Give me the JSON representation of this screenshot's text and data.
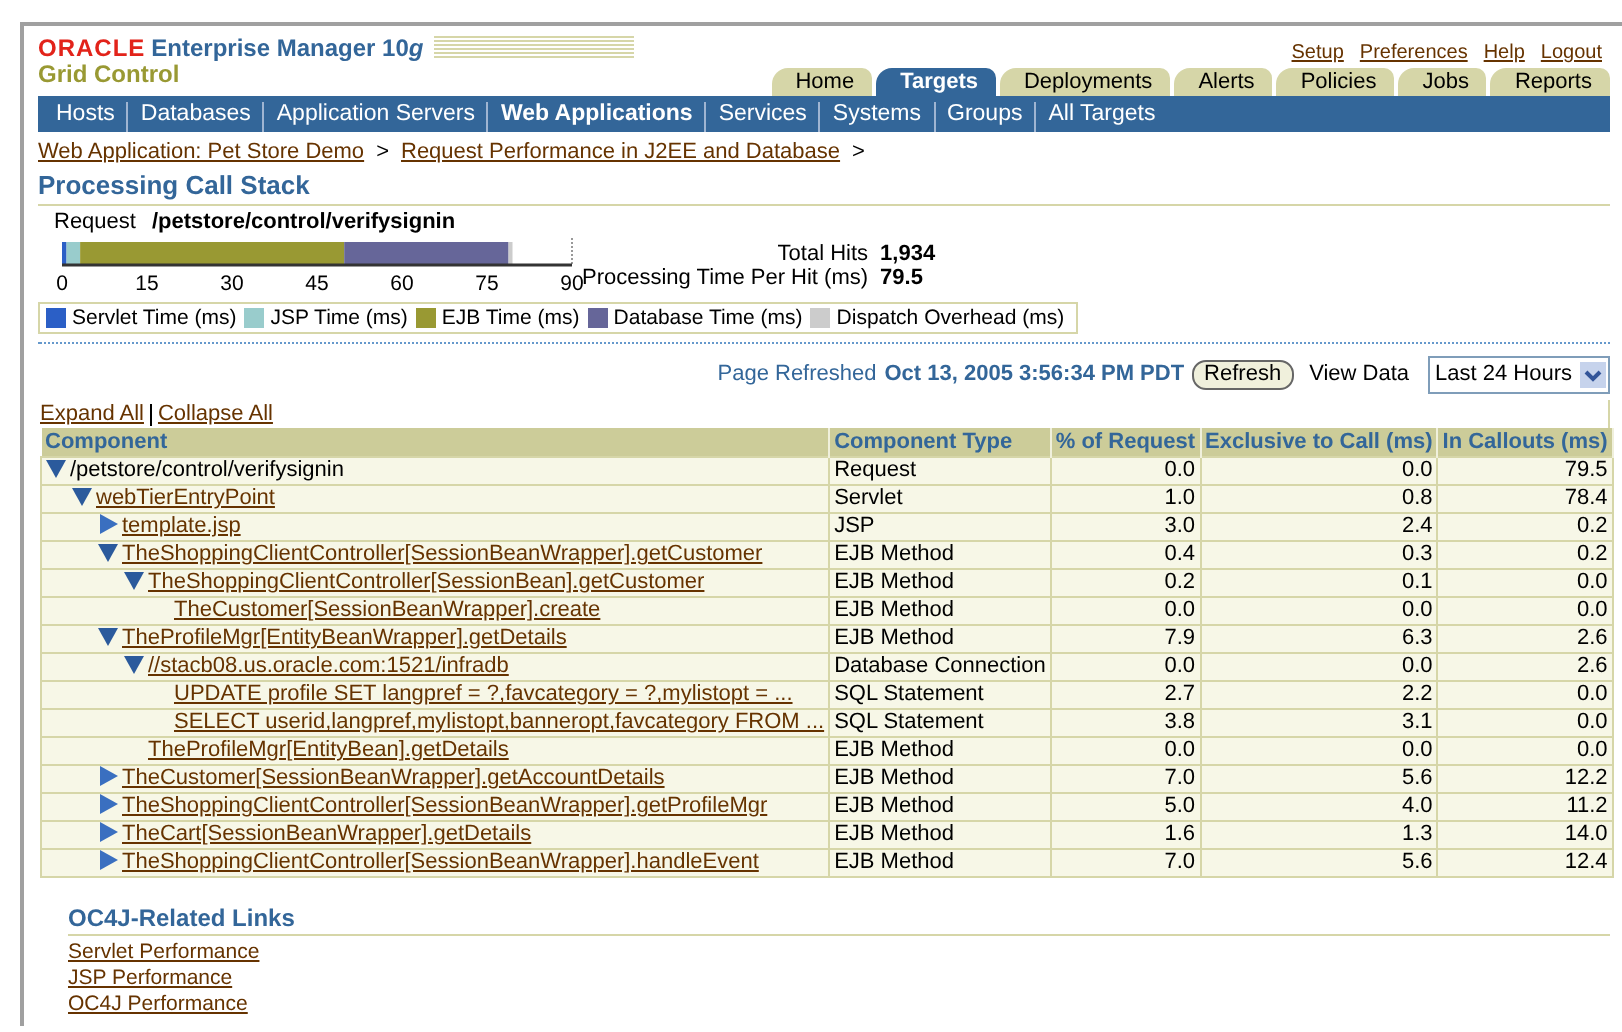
{
  "header": {
    "logo": "ORACLE",
    "product": "Enterprise Manager 10",
    "product_version_suffix": "g",
    "subtitle": "Grid Control",
    "global_links": [
      "Setup",
      "Preferences",
      "Help",
      "Logout"
    ]
  },
  "tabs": [
    {
      "label": "Home",
      "selected": false
    },
    {
      "label": "Targets",
      "selected": true
    },
    {
      "label": "Deployments",
      "selected": false
    },
    {
      "label": "Alerts",
      "selected": false
    },
    {
      "label": "Policies",
      "selected": false
    },
    {
      "label": "Jobs",
      "selected": false
    },
    {
      "label": "Reports",
      "selected": false
    }
  ],
  "subtabs": [
    {
      "label": "Hosts",
      "selected": false
    },
    {
      "label": "Databases",
      "selected": false
    },
    {
      "label": "Application Servers",
      "selected": false
    },
    {
      "label": "Web Applications",
      "selected": true
    },
    {
      "label": "Services",
      "selected": false
    },
    {
      "label": "Systems",
      "selected": false
    },
    {
      "label": "Groups",
      "selected": false
    },
    {
      "label": "All Targets",
      "selected": false
    }
  ],
  "breadcrumbs": [
    {
      "kind": "link",
      "text": "Web Application: Pet Store Demo"
    },
    {
      "kind": "separator",
      "text": ">"
    },
    {
      "kind": "link",
      "text": "Request Performance in J2EE and Database"
    },
    {
      "kind": "separator",
      "text": ">"
    }
  ],
  "page_title": "Processing Call Stack",
  "request": {
    "label": "Request",
    "value": "/petstore/control/verifysignin"
  },
  "chart_data": {
    "type": "bar",
    "orientation": "horizontal",
    "stacked": true,
    "xlim": [
      0,
      90
    ],
    "xticks": [
      0,
      15,
      30,
      45,
      60,
      75,
      90
    ],
    "series": [
      {
        "name": "Servlet Time (ms)",
        "color": "#2b5fc6",
        "values": [
          0.8
        ]
      },
      {
        "name": "JSP Time (ms)",
        "color": "#99cccc",
        "values": [
          2.4
        ]
      },
      {
        "name": "EJB Time (ms)",
        "color": "#999933",
        "values": [
          46.6
        ]
      },
      {
        "name": "Database Time (ms)",
        "color": "#666699",
        "values": [
          29.0
        ]
      },
      {
        "name": "Dispatch Overhead (ms)",
        "color": "#cccccc",
        "values": [
          0.7
        ]
      }
    ]
  },
  "stats": [
    {
      "label": "Total Hits",
      "value": "1,934"
    },
    {
      "label": "Processing Time Per Hit (ms)",
      "value": "79.5"
    }
  ],
  "refresh": {
    "label": "Page Refreshed",
    "timestamp": "Oct 13, 2005 3:56:34 PM PDT",
    "button": "Refresh",
    "view_label": "View Data",
    "view_value": "Last 24 Hours"
  },
  "tree_actions": [
    "Expand All",
    "Collapse All"
  ],
  "table": {
    "columns": [
      "Component",
      "Component Type",
      "% of Request",
      "Exclusive to Call (ms)",
      "In Callouts (ms)"
    ],
    "rows": [
      {
        "name": "/petstore/control/verifysignin",
        "link": false,
        "expanded": true,
        "type": "Request",
        "percent": "0.0",
        "exclusive": "0.0",
        "callouts": "79.5",
        "children": [
          {
            "name": "webTierEntryPoint",
            "link": true,
            "expanded": true,
            "type": "Servlet",
            "percent": "1.0",
            "exclusive": "0.8",
            "callouts": "78.4",
            "children": [
              {
                "name": "template.jsp",
                "link": true,
                "expanded": false,
                "type": "JSP",
                "percent": "3.0",
                "exclusive": "2.4",
                "callouts": "0.2"
              },
              {
                "name": "TheShoppingClientController[SessionBeanWrapper].getCustomer",
                "link": true,
                "expanded": true,
                "type": "EJB Method",
                "percent": "0.4",
                "exclusive": "0.3",
                "callouts": "0.2",
                "children": [
                  {
                    "name": "TheShoppingClientController[SessionBean].getCustomer",
                    "link": true,
                    "expanded": true,
                    "type": "EJB Method",
                    "percent": "0.2",
                    "exclusive": "0.1",
                    "callouts": "0.0",
                    "children": [
                      {
                        "name": "TheCustomer[SessionBeanWrapper].create",
                        "link": true,
                        "type": "EJB Method",
                        "percent": "0.0",
                        "exclusive": "0.0",
                        "callouts": "0.0"
                      }
                    ]
                  }
                ]
              },
              {
                "name": "TheProfileMgr[EntityBeanWrapper].getDetails",
                "link": true,
                "expanded": true,
                "type": "EJB Method",
                "percent": "7.9",
                "exclusive": "6.3",
                "callouts": "2.6",
                "children": [
                  {
                    "name": "//stacb08.us.oracle.com:1521/infradb",
                    "link": true,
                    "expanded": true,
                    "type": "Database Connection",
                    "percent": "0.0",
                    "exclusive": "0.0",
                    "callouts": "2.6",
                    "children": [
                      {
                        "name": "UPDATE profile SET langpref = ?,favcategory = ?,mylistopt = ...",
                        "link": true,
                        "type": "SQL Statement",
                        "percent": "2.7",
                        "exclusive": "2.2",
                        "callouts": "0.0"
                      },
                      {
                        "name": "SELECT userid,langpref,mylistopt,banneropt,favcategory FROM ...",
                        "link": true,
                        "type": "SQL Statement",
                        "percent": "3.8",
                        "exclusive": "3.1",
                        "callouts": "0.0"
                      }
                    ]
                  },
                  {
                    "name": "TheProfileMgr[EntityBean].getDetails",
                    "link": true,
                    "type": "EJB Method",
                    "percent": "0.0",
                    "exclusive": "0.0",
                    "callouts": "0.0"
                  }
                ]
              },
              {
                "name": "TheCustomer[SessionBeanWrapper].getAccountDetails",
                "link": true,
                "expanded": false,
                "type": "EJB Method",
                "percent": "7.0",
                "exclusive": "5.6",
                "callouts": "12.2"
              },
              {
                "name": "TheShoppingClientController[SessionBeanWrapper].getProfileMgr",
                "link": true,
                "expanded": false,
                "type": "EJB Method",
                "percent": "5.0",
                "exclusive": "4.0",
                "callouts": "11.2"
              },
              {
                "name": "TheCart[SessionBeanWrapper].getDetails",
                "link": true,
                "expanded": false,
                "type": "EJB Method",
                "percent": "1.6",
                "exclusive": "1.3",
                "callouts": "14.0"
              },
              {
                "name": "TheShoppingClientController[SessionBeanWrapper].handleEvent",
                "link": true,
                "expanded": false,
                "type": "EJB Method",
                "percent": "7.0",
                "exclusive": "5.6",
                "callouts": "12.4"
              }
            ]
          }
        ]
      }
    ]
  },
  "related": {
    "title": "OC4J-Related Links",
    "links": [
      "Servlet Performance",
      "JSP Performance",
      "OC4J Performance"
    ]
  }
}
